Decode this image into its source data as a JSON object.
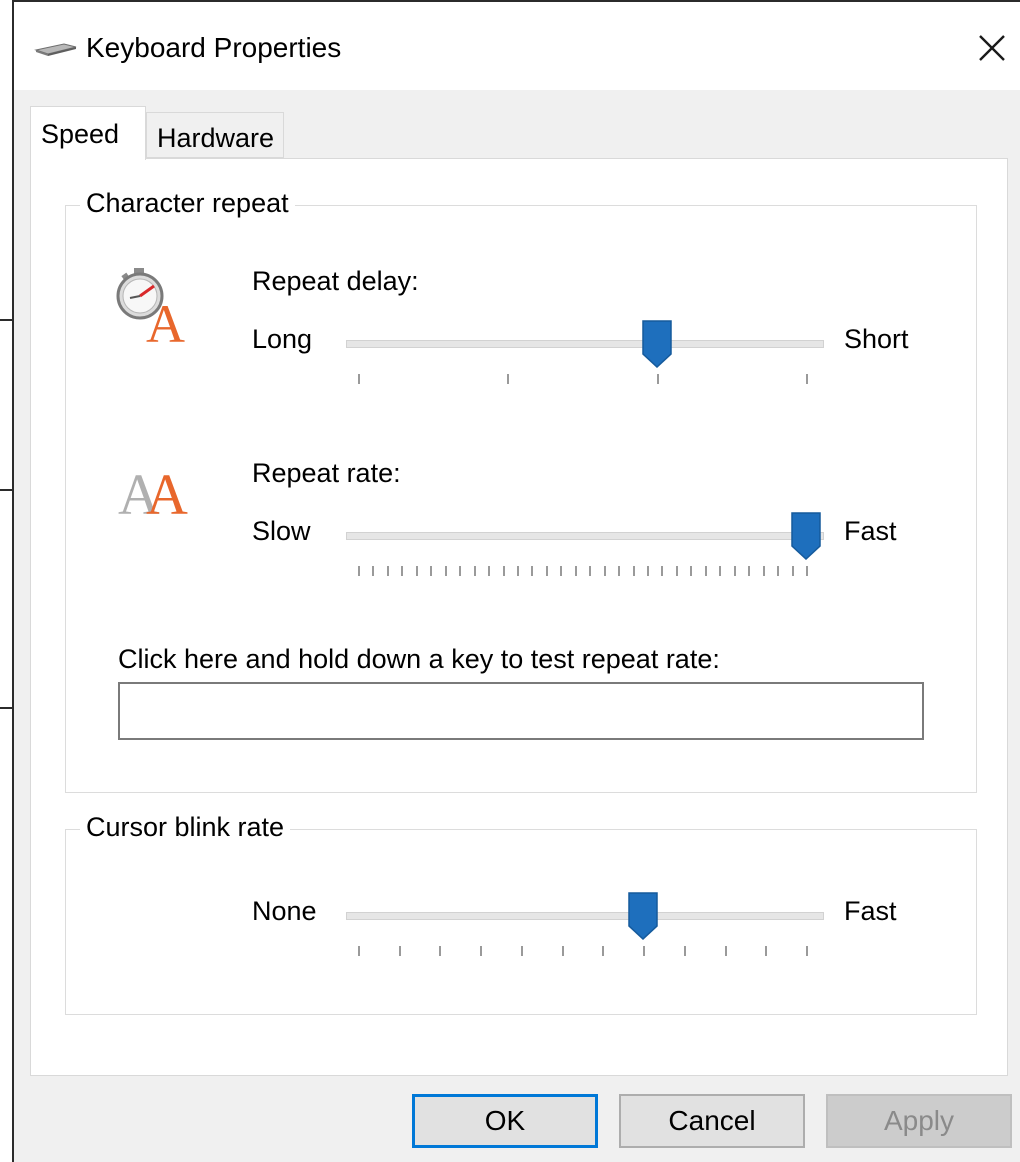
{
  "window": {
    "title": "Keyboard Properties"
  },
  "tabs": [
    {
      "label": "Speed",
      "selected": true
    },
    {
      "label": "Hardware",
      "selected": false
    }
  ],
  "character_repeat": {
    "group_label": "Character repeat",
    "repeat_delay": {
      "label": "Repeat delay:",
      "min_label": "Long",
      "max_label": "Short",
      "tick_count": 4,
      "value_fraction": 0.667,
      "icon": "stopwatch-a-icon"
    },
    "repeat_rate": {
      "label": "Repeat rate:",
      "min_label": "Slow",
      "max_label": "Fast",
      "tick_count": 32,
      "value_fraction": 1.0,
      "icon": "double-a-icon"
    },
    "test_label": "Click here and hold down a key to test repeat rate:",
    "test_value": ""
  },
  "cursor_blink": {
    "group_label": "Cursor blink rate",
    "min_label": "None",
    "max_label": "Fast",
    "tick_count": 12,
    "value_fraction": 0.636
  },
  "buttons": {
    "ok": "OK",
    "cancel": "Cancel",
    "apply": "Apply"
  },
  "colors": {
    "accent": "#0078d7",
    "slider_thumb": "#1e6fbd",
    "icon_orange": "#e8672c"
  }
}
